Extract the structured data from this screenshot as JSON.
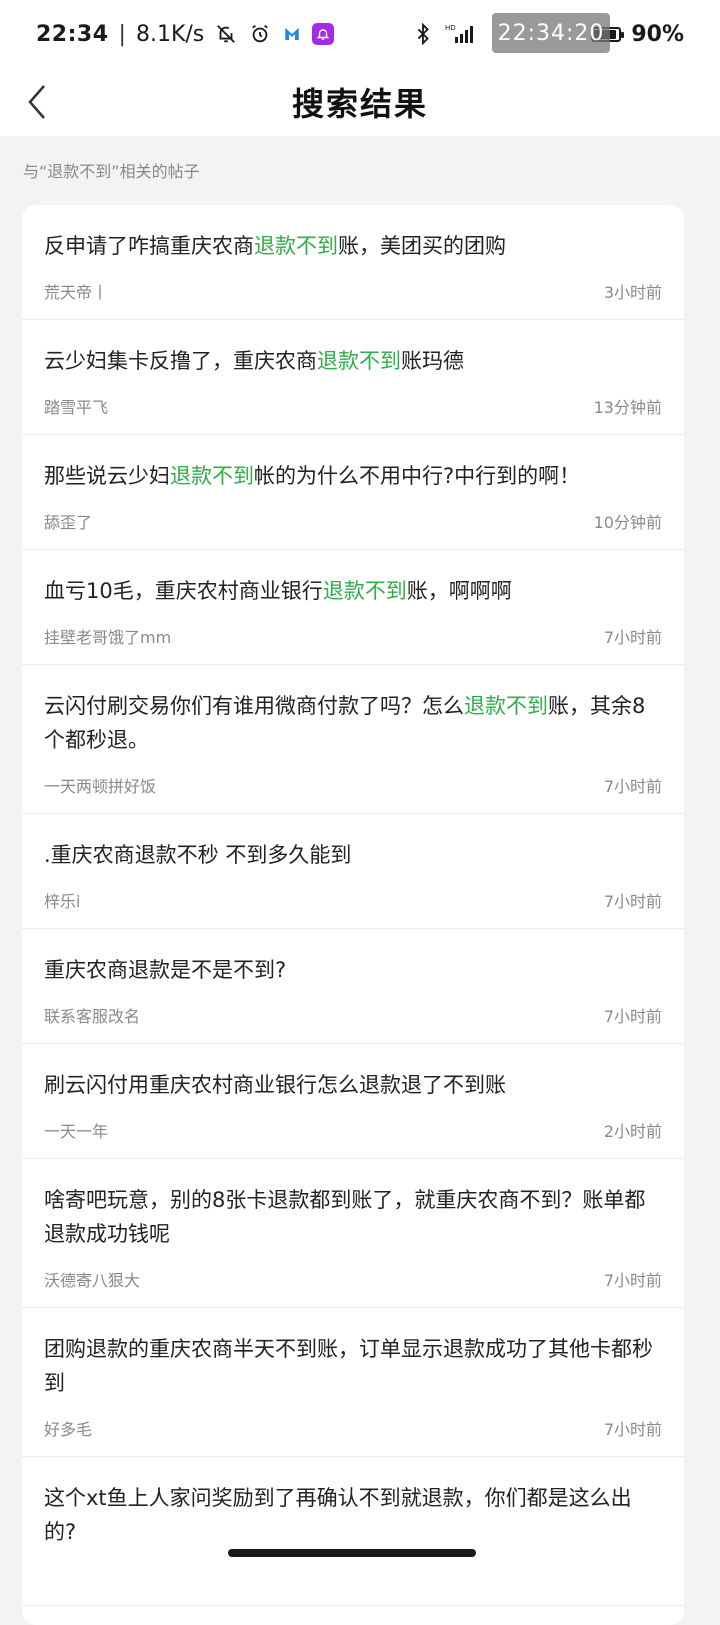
{
  "status_bar": {
    "time": "22:34",
    "separator": "|",
    "net_speed": "8.1K/s",
    "clock_overlay": "22:34:20",
    "battery_level": 0.9,
    "battery_percent": "90%",
    "signal_label": "HD"
  },
  "header": {
    "title": "搜索结果"
  },
  "caption": "与“退款不到”相关的帖子",
  "highlight_color": "#2fae4a",
  "posts": [
    {
      "before": "反申请了咋搞重庆农商",
      "highlight": "退款不到",
      "after": "账，美团买的团购",
      "author": "荒天帝丨",
      "time": "3小时前"
    },
    {
      "before": "云少妇集卡反撸了，重庆农商",
      "highlight": "退款不到",
      "after": "账玛德",
      "author": "踏雪平飞",
      "time": "13分钟前"
    },
    {
      "before": "那些说云少妇",
      "highlight": "退款不到",
      "after": "帐的为什么不用中行?中行到的啊！",
      "author": "舔歪了",
      "time": "10分钟前"
    },
    {
      "before": "血亏10毛，重庆农村商业银行",
      "highlight": "退款不到",
      "after": "账，啊啊啊",
      "author": "挂壁老哥饿了mm",
      "time": "7小时前"
    },
    {
      "before": "云闪付刷交易你们有谁用微商付款了吗？怎么",
      "highlight": "退款不到",
      "after": "账，其余8个都秒退。",
      "author": "一天两顿拼好饭",
      "time": "7小时前"
    },
    {
      "before": ".重庆农商退款不秒 不到多久能到",
      "highlight": "",
      "after": "",
      "author": "梓乐i",
      "time": "7小时前"
    },
    {
      "before": "重庆农商退款是不是不到?",
      "highlight": "",
      "after": "",
      "author": "联系客服改名",
      "time": "7小时前"
    },
    {
      "before": "刷云闪付用重庆农村商业银行怎么退款退了不到账",
      "highlight": "",
      "after": "",
      "author": "一天一年",
      "time": "2小时前"
    },
    {
      "before": "啥寄吧玩意，别的8张卡退款都到账了，就重庆农商不到？账单都退款成功钱呢",
      "highlight": "",
      "after": "",
      "author": "沃德寄八狠大",
      "time": "7小时前"
    },
    {
      "before": "团购退款的重庆农商半天不到账，订单显示退款成功了其他卡都秒到",
      "highlight": "",
      "after": "",
      "author": "好多毛",
      "time": "7小时前"
    },
    {
      "before": "这个xt鱼上人家问奖励到了再确认不到就退款，你们都是这么出的?",
      "highlight": "",
      "after": "",
      "author": "",
      "time": ""
    }
  ]
}
